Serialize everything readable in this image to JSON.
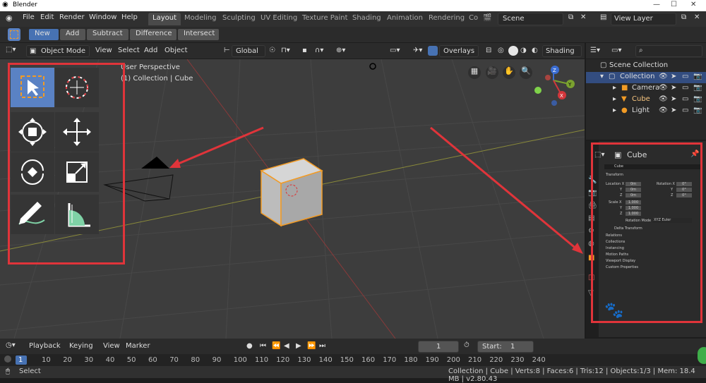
{
  "window": {
    "title": "Blender"
  },
  "menu": {
    "items": [
      "File",
      "Edit",
      "Render",
      "Window",
      "Help"
    ]
  },
  "workspaces": {
    "tabs": [
      "Layout",
      "Modeling",
      "Sculpting",
      "UV Editing",
      "Texture Paint",
      "Shading",
      "Animation",
      "Rendering",
      "Co"
    ],
    "active": "Layout"
  },
  "scene": {
    "name": "Scene"
  },
  "viewlayer": {
    "name": "View Layer"
  },
  "boolean_toolbar": {
    "buttons": [
      "New",
      "Add",
      "Subtract",
      "Difference",
      "Intersect"
    ],
    "active": "New"
  },
  "viewport_header": {
    "mode": "Object Mode",
    "menus": [
      "View",
      "Select",
      "Add",
      "Object"
    ],
    "orientation": "Global",
    "overlays": "Overlays",
    "shading": "Shading"
  },
  "viewport": {
    "perspective": "User Perspective",
    "context": "(1) Collection | Cube"
  },
  "outliner": {
    "rows": [
      {
        "label": "Scene Collection"
      },
      {
        "label": "Collection"
      },
      {
        "label": "Camera"
      },
      {
        "label": "Cube"
      },
      {
        "label": "Light"
      }
    ]
  },
  "properties": {
    "object_name": "Cube",
    "name_field": "Cube",
    "transform_label": "Transform",
    "location_label": "Location X",
    "rotation_label": "Rotation X",
    "loc_values": [
      "0m",
      "0m",
      "0m"
    ],
    "rot_values": [
      "0°",
      "0°",
      "0°"
    ],
    "scale_label": "Scale X",
    "scale_values": [
      "1.000",
      "1.000",
      "1.000"
    ],
    "axis_y": "Y",
    "axis_z": "Z",
    "rotation_mode_label": "Rotation Mode",
    "rotation_mode": "XYZ Euler",
    "delta_transform": "Delta Transform",
    "sections": [
      "Relations",
      "Collections",
      "Instancing",
      "Motion Paths",
      "Viewport Display",
      "Custom Properties"
    ]
  },
  "timeline": {
    "menus": [
      "Playback",
      "Keying",
      "View",
      "Marker"
    ],
    "current_frame": "1",
    "start_label": "Start:",
    "start_value": "1",
    "ruler_ticks": [
      "1",
      "10",
      "20",
      "30",
      "40",
      "50",
      "60",
      "70",
      "80",
      "90",
      "100",
      "110",
      "120",
      "130",
      "140",
      "150",
      "160",
      "170",
      "180",
      "190",
      "200",
      "210",
      "220",
      "230",
      "240"
    ]
  },
  "statusbar": {
    "left": "Select",
    "right": "Collection | Cube | Verts:8 | Faces:6 | Tris:12 | Objects:1/3 | Mem: 18.4 MB | v2.80.43"
  },
  "colors": {
    "accent": "#4772b3",
    "highlight_red": "#e0343a",
    "selection_orange": "#f29b25"
  }
}
